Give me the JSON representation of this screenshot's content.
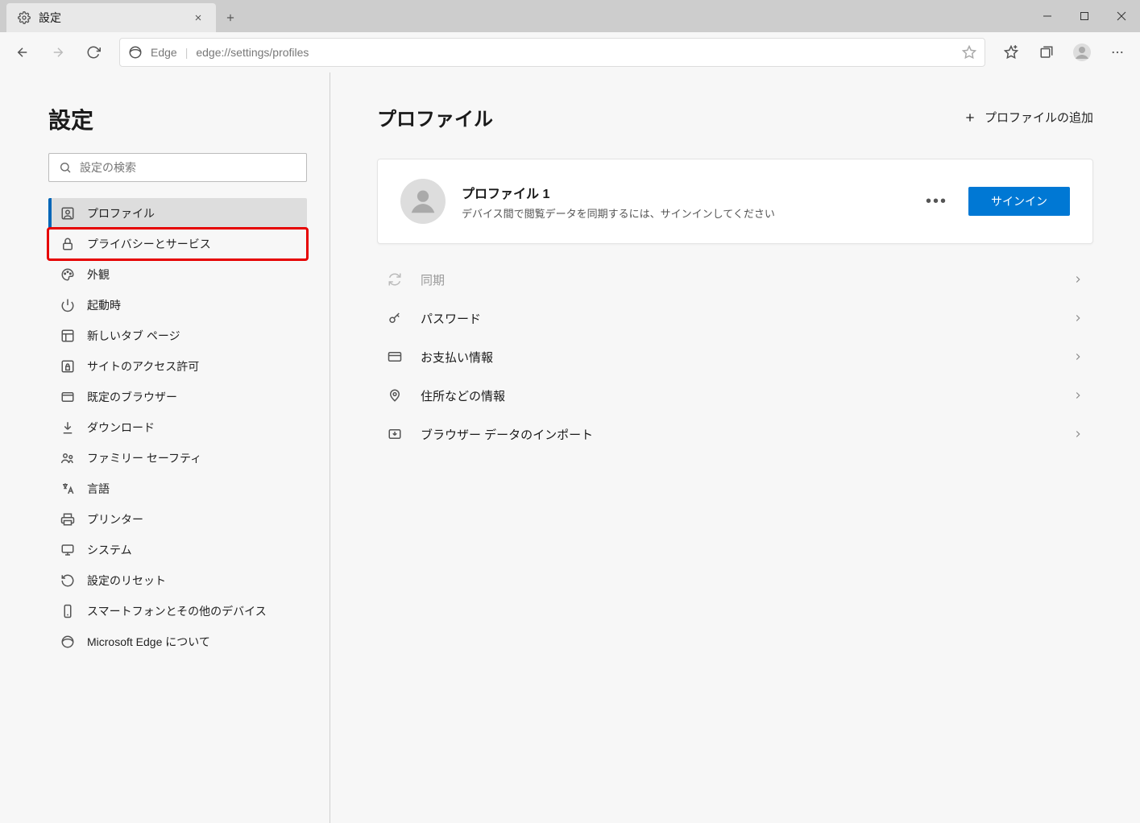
{
  "tab": {
    "title": "設定"
  },
  "toolbar": {
    "url_label": "Edge",
    "url_text": "edge://settings/profiles"
  },
  "sidebar": {
    "title": "設定",
    "search_placeholder": "設定の検索",
    "items": [
      {
        "label": "プロファイル",
        "icon": "user-box",
        "active": true
      },
      {
        "label": "プライバシーとサービス",
        "icon": "lock",
        "highlighted": true
      },
      {
        "label": "外観",
        "icon": "palette"
      },
      {
        "label": "起動時",
        "icon": "power"
      },
      {
        "label": "新しいタブ ページ",
        "icon": "window-grid"
      },
      {
        "label": "サイトのアクセス許可",
        "icon": "site-lock"
      },
      {
        "label": "既定のブラウザー",
        "icon": "browser-default"
      },
      {
        "label": "ダウンロード",
        "icon": "download"
      },
      {
        "label": "ファミリー セーフティ",
        "icon": "family"
      },
      {
        "label": "言語",
        "icon": "language"
      },
      {
        "label": "プリンター",
        "icon": "printer"
      },
      {
        "label": "システム",
        "icon": "system"
      },
      {
        "label": "設定のリセット",
        "icon": "reset"
      },
      {
        "label": "スマートフォンとその他のデバイス",
        "icon": "phone"
      },
      {
        "label": "Microsoft Edge について",
        "icon": "edge"
      }
    ]
  },
  "main": {
    "heading": "プロファイル",
    "add_profile": "プロファイルの追加",
    "profile": {
      "title": "プロファイル 1",
      "desc": "デバイス間で閲覧データを同期するには、サインインしてください",
      "signin": "サインイン"
    },
    "rows": [
      {
        "label": "同期",
        "icon": "sync",
        "disabled": true
      },
      {
        "label": "パスワード",
        "icon": "key"
      },
      {
        "label": "お支払い情報",
        "icon": "card"
      },
      {
        "label": "住所などの情報",
        "icon": "location"
      },
      {
        "label": "ブラウザー データのインポート",
        "icon": "import"
      }
    ]
  }
}
